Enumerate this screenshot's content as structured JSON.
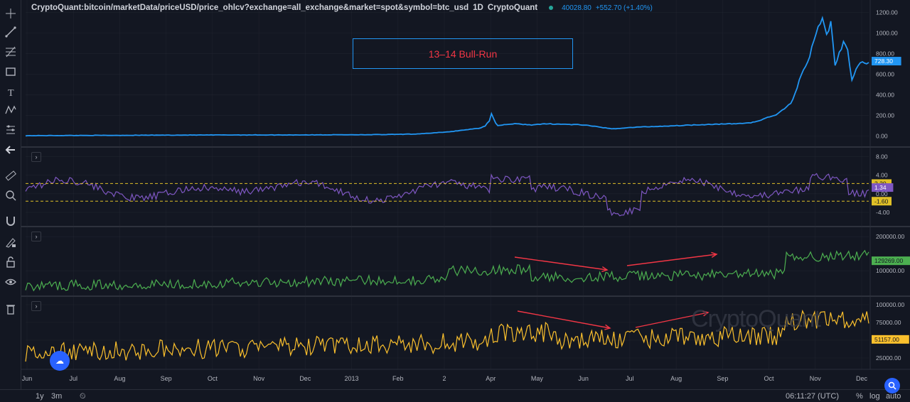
{
  "legend": {
    "symbol": "CryptoQuant:bitcoin/marketData/priceUSD/price_ohlcv?exchange=all_exchange&market=spot&symbol=btc_usd",
    "interval": "1D",
    "source": "CryptoQuant",
    "value": "40028.80",
    "change": "+552.70 (+1.40%)"
  },
  "annotation": {
    "text": "13–14 Bull-Run"
  },
  "watermark": "CryptoQuant",
  "toolbar": {
    "tools": [
      "crosshair-icon",
      "trendline-icon",
      "fib-icon",
      "rectangle-icon",
      "text-icon",
      "pattern-icon",
      "measure-icon",
      "back-arrow-icon",
      "ruler-icon",
      "zoom-icon",
      "magnet-icon",
      "lock-draw-icon",
      "lock-icon",
      "eye-icon",
      "trash-icon"
    ]
  },
  "bottombar": {
    "ranges": [
      "1y",
      "3m"
    ],
    "time": "06:11:27 (UTC)",
    "percent": "%",
    "log": "log",
    "auto": "auto"
  },
  "colors": {
    "background": "#131722",
    "price": "#2196f3",
    "oscillator": "#7e57c2",
    "green_series": "#4caf50",
    "orange_series": "#fbc02d",
    "threshold": "#e0c027",
    "arrow": "#f23645",
    "grid": "#2a2e39"
  },
  "chart_data": {
    "type": "line",
    "x_labels": [
      "Jun",
      "Jul",
      "Aug",
      "Sep",
      "Oct",
      "Nov",
      "Dec",
      "2013",
      "Feb",
      "2",
      "Apr",
      "May",
      "Jun",
      "Jul",
      "Aug",
      "Sep",
      "Oct",
      "Nov",
      "Dec"
    ],
    "panes": [
      {
        "name": "price",
        "color": "#2196f3",
        "ylim": [
          -50,
          1280
        ],
        "ticks": [
          "1200.00",
          "1000.00",
          "800.00",
          "600.00",
          "400.00",
          "200.00",
          "0.00"
        ],
        "tick_values": [
          1200,
          1000,
          800,
          600,
          400,
          200,
          0
        ],
        "last_label": "728.30",
        "last_value": 728.3,
        "points": [
          [
            0,
            5
          ],
          [
            0.05,
            7
          ],
          [
            0.1,
            8
          ],
          [
            0.15,
            10
          ],
          [
            0.2,
            11
          ],
          [
            0.25,
            12
          ],
          [
            0.3,
            12
          ],
          [
            0.35,
            13
          ],
          [
            0.38,
            14
          ],
          [
            0.42,
            15
          ],
          [
            0.46,
            20
          ],
          [
            0.48,
            30
          ],
          [
            0.5,
            40
          ],
          [
            0.52,
            60
          ],
          [
            0.54,
            80
          ],
          [
            0.545,
            100
          ],
          [
            0.55,
            150
          ],
          [
            0.553,
            240
          ],
          [
            0.556,
            140
          ],
          [
            0.56,
            100
          ],
          [
            0.565,
            110
          ],
          [
            0.58,
            120
          ],
          [
            0.6,
            110
          ],
          [
            0.62,
            120
          ],
          [
            0.64,
            115
          ],
          [
            0.66,
            110
          ],
          [
            0.68,
            90
          ],
          [
            0.695,
            70
          ],
          [
            0.71,
            80
          ],
          [
            0.73,
            90
          ],
          [
            0.75,
            95
          ],
          [
            0.78,
            105
          ],
          [
            0.81,
            115
          ],
          [
            0.84,
            120
          ],
          [
            0.86,
            130
          ],
          [
            0.87,
            150
          ],
          [
            0.88,
            180
          ],
          [
            0.89,
            210
          ],
          [
            0.9,
            260
          ],
          [
            0.91,
            350
          ],
          [
            0.92,
            600
          ],
          [
            0.93,
            780
          ],
          [
            0.94,
            1050
          ],
          [
            0.945,
            1150
          ],
          [
            0.95,
            980
          ],
          [
            0.955,
            1100
          ],
          [
            0.96,
            700
          ],
          [
            0.97,
            900
          ],
          [
            0.975,
            820
          ],
          [
            0.98,
            550
          ],
          [
            0.985,
            650
          ],
          [
            0.99,
            700
          ],
          [
            1.0,
            728
          ]
        ]
      },
      {
        "name": "oscillator",
        "color": "#7e57c2",
        "ylim": [
          -6,
          9
        ],
        "ticks": [
          "8.00",
          "4.00",
          "0.00",
          "-4.00"
        ],
        "tick_values": [
          8,
          4,
          0,
          -4
        ],
        "thresholds": [
          {
            "label": "2.20",
            "value": 2.2
          },
          {
            "label": "-1.60",
            "value": -1.6
          }
        ],
        "last_label": "1.34",
        "last_value": 1.34
      },
      {
        "name": "green",
        "color": "#4caf50",
        "ylim": [
          40000,
          215000
        ],
        "ticks": [
          "200000.00",
          "100000.00"
        ],
        "tick_values": [
          200000,
          100000
        ],
        "last_label": "129269.00",
        "last_value": 129269
      },
      {
        "name": "orange",
        "color": "#fbc02d",
        "ylim": [
          15000,
          105000
        ],
        "ticks": [
          "100000.00",
          "75000.00",
          "50000.00",
          "25000.00"
        ],
        "tick_values": [
          100000,
          75000,
          50000,
          25000
        ],
        "last_label": "51157.00",
        "last_value": 51157
      }
    ]
  }
}
